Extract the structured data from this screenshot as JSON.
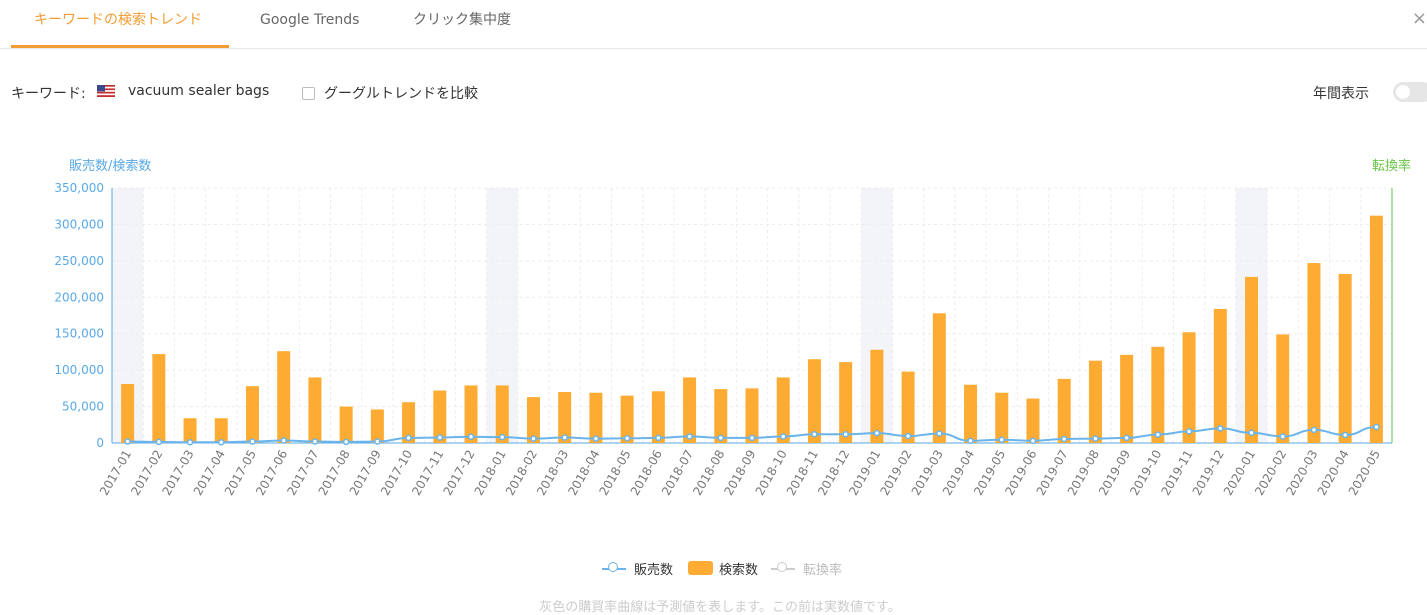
{
  "tabs": [
    {
      "label": "キーワードの検索トレンド",
      "active": true
    },
    {
      "label": "Google Trends",
      "active": false
    },
    {
      "label": "クリック集中度",
      "active": false
    }
  ],
  "close_symbol": "×",
  "keyword": {
    "label": "キーワード:",
    "flag_icon": "us-flag-icon",
    "value": "vacuum sealer bags"
  },
  "compare": {
    "label": "グーグルトレンドを比較",
    "checked": false
  },
  "year_view": {
    "label": "年間表示",
    "enabled": false
  },
  "legend": {
    "sales": "販売数",
    "searches": "検索数",
    "conversion": "転換率"
  },
  "note": "灰色の購買率曲線は予測値を表します。この前は実数値です。",
  "colors": {
    "accent": "#f39c33",
    "bar": "#fdab33",
    "sales_line": "#6ab4ec",
    "left_axis": "#5aa9e6",
    "right_axis": "#68c444",
    "conversion_line": "#cccccc",
    "year_band": "#f3f4f8"
  },
  "chart_data": {
    "type": "bar",
    "ylabel_left": "販売数/検索数",
    "ylabel_right": "転換率",
    "ylim": [
      0,
      350000
    ],
    "yticks": [
      "0",
      "50,000",
      "100,000",
      "150,000",
      "200,000",
      "250,000",
      "300,000",
      "350,000"
    ],
    "grid": true,
    "highlighted_categories": [
      "2017-01",
      "2018-01",
      "2019-01",
      "2020-01"
    ],
    "categories": [
      "2017-01",
      "2017-02",
      "2017-03",
      "2017-04",
      "2017-05",
      "2017-06",
      "2017-07",
      "2017-08",
      "2017-09",
      "2017-10",
      "2017-11",
      "2017-12",
      "2018-01",
      "2018-02",
      "2018-03",
      "2018-04",
      "2018-05",
      "2018-06",
      "2018-07",
      "2018-08",
      "2018-09",
      "2018-10",
      "2018-11",
      "2018-12",
      "2019-01",
      "2019-02",
      "2019-03",
      "2019-04",
      "2019-05",
      "2019-06",
      "2019-07",
      "2019-08",
      "2019-09",
      "2019-10",
      "2019-11",
      "2019-12",
      "2020-01",
      "2020-02",
      "2020-03",
      "2020-04",
      "2020-05"
    ],
    "series": [
      {
        "name": "検索数",
        "type": "bar",
        "values": [
          81000,
          122000,
          34000,
          34000,
          78000,
          126000,
          90000,
          50000,
          46000,
          56000,
          72000,
          79000,
          79000,
          63000,
          70000,
          69000,
          65000,
          71000,
          90000,
          74000,
          75000,
          90000,
          115000,
          111000,
          128000,
          98000,
          178000,
          80000,
          69000,
          61000,
          88000,
          113000,
          121000,
          132000,
          152000,
          184000,
          228000,
          149000,
          247000,
          232000,
          312000
        ]
      },
      {
        "name": "販売数",
        "type": "line",
        "values": [
          2000,
          1500,
          1000,
          1000,
          2000,
          3500,
          2000,
          1500,
          2000,
          7000,
          7500,
          8500,
          8000,
          6000,
          7500,
          6000,
          6500,
          7000,
          9000,
          7000,
          7000,
          9000,
          12000,
          12000,
          13500,
          9500,
          13000,
          3000,
          4500,
          3000,
          5500,
          6000,
          7000,
          11500,
          16000,
          20000,
          14000,
          9000,
          18000,
          11000,
          22000
        ]
      }
    ]
  }
}
